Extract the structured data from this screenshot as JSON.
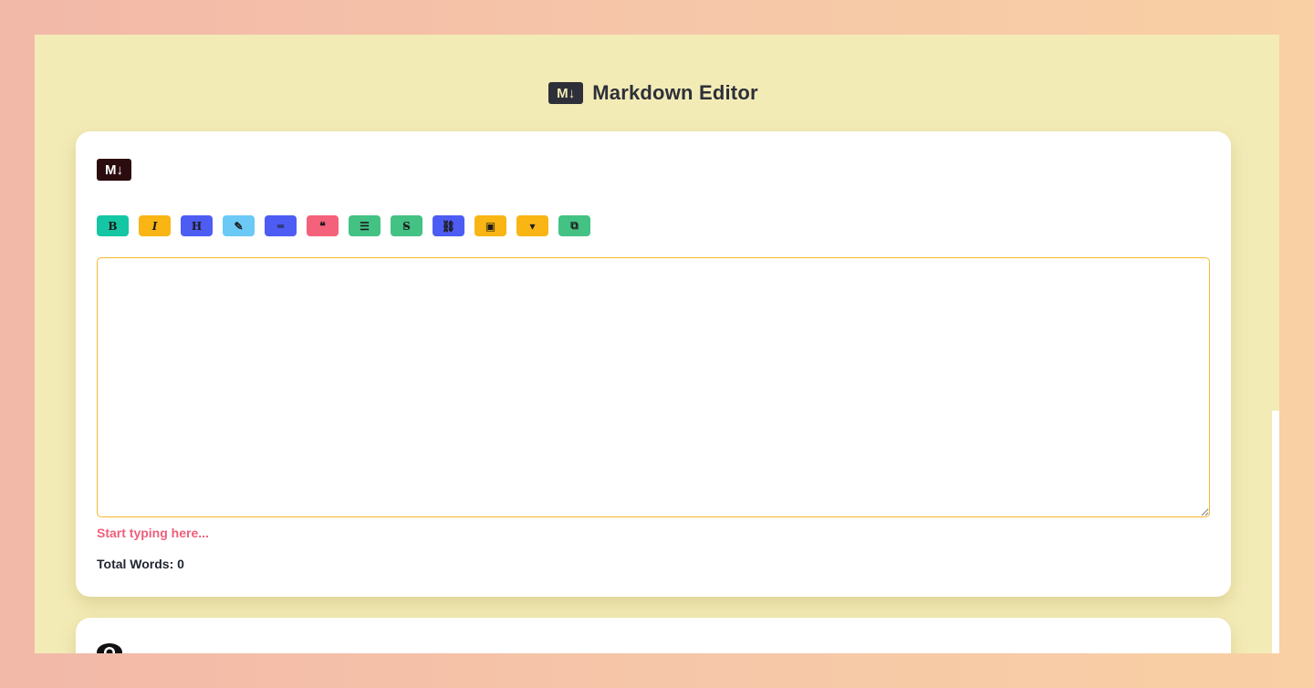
{
  "header": {
    "logo_text": "M↓",
    "title": "Markdown Editor"
  },
  "editor_card": {
    "logo_text": "M↓",
    "toolbar": [
      {
        "name": "bold-button",
        "glyph": "B",
        "color": "#15c6a4",
        "icon": "bold-icon"
      },
      {
        "name": "italic-button",
        "glyph": "I",
        "color": "#f8b514",
        "icon": "italic-icon"
      },
      {
        "name": "heading-button",
        "glyph": "H",
        "color": "#4d5df4",
        "icon": "heading-icon"
      },
      {
        "name": "highlight-button",
        "glyph": "✎",
        "color": "#6bc9f5",
        "icon": "marker-icon"
      },
      {
        "name": "hr-button",
        "glyph": "═",
        "color": "#4d5df4",
        "icon": "equals-icon"
      },
      {
        "name": "quote-button",
        "glyph": "❝",
        "color": "#f4617b",
        "icon": "quote-icon"
      },
      {
        "name": "list-button",
        "glyph": "☰",
        "color": "#43c284",
        "icon": "list-icon"
      },
      {
        "name": "strikethrough-button",
        "glyph": "S̶",
        "color": "#43c284",
        "icon": "strikethrough-icon"
      },
      {
        "name": "link-button",
        "glyph": "⛓",
        "color": "#4d5df4",
        "icon": "link-icon"
      },
      {
        "name": "image-button",
        "glyph": "▣",
        "color": "#f8b514",
        "icon": "image-icon"
      },
      {
        "name": "dropdown-button",
        "glyph": "▾",
        "color": "#f8b514",
        "icon": "caret-down-icon"
      },
      {
        "name": "copy-button",
        "glyph": "⧉",
        "color": "#43c284",
        "icon": "copy-icon"
      }
    ],
    "textarea_value": "",
    "hint": "Start typing here...",
    "word_count_label": "Total Words: 0"
  },
  "preview_card": {
    "icon": "eye-icon"
  }
}
